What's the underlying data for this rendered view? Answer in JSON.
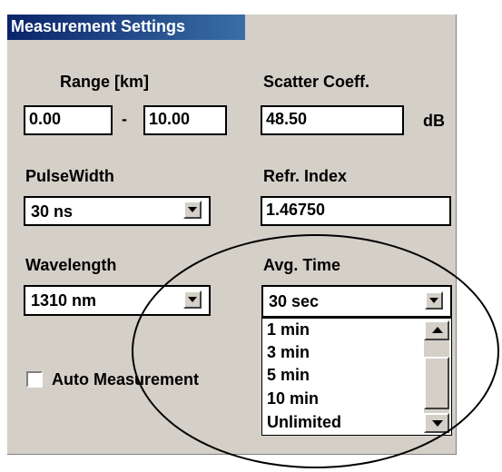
{
  "window": {
    "title": "Measurement Settings"
  },
  "range": {
    "label": "Range [km]",
    "from": "0.00",
    "separator": "-",
    "to": "10.00"
  },
  "scatter": {
    "label": "Scatter Coeff.",
    "value": "48.50",
    "unit": "dB"
  },
  "pulse_width": {
    "label": "PulseWidth",
    "selected": "30 ns"
  },
  "refr_index": {
    "label": "Refr. Index",
    "value": "1.46750"
  },
  "wavelength": {
    "label": "Wavelength",
    "selected": "1310 nm"
  },
  "avg_time": {
    "label": "Avg. Time",
    "selected": "30 sec",
    "options": [
      "1 min",
      "3 min",
      "5 min",
      "10 min",
      "Unlimited"
    ]
  },
  "auto_measurement": {
    "label": "Auto Measurement",
    "checked": false
  },
  "colors": {
    "titlebar": "#0a246a",
    "panel": "#d4d0c8"
  }
}
